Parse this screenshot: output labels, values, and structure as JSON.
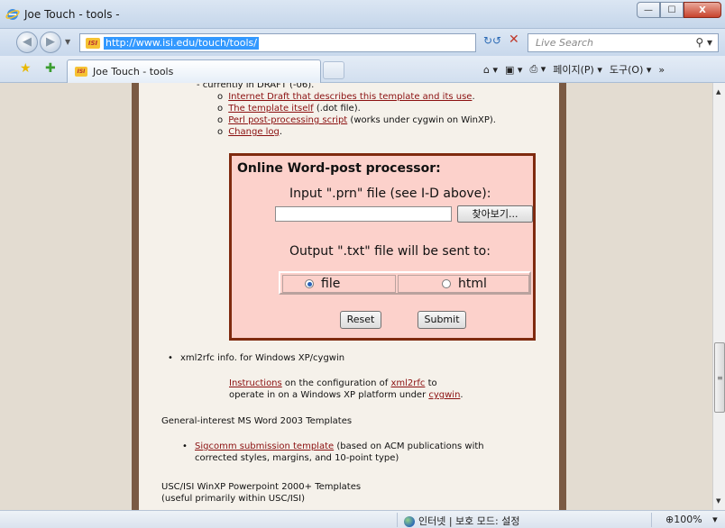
{
  "window": {
    "title": "Joe Touch - tools -",
    "minimize": "—",
    "maximize": "☐",
    "close": "X"
  },
  "nav": {
    "url": "http://www.isi.edu/touch/tools/",
    "search_placeholder": "Live Search",
    "back_glyph": "◀",
    "forward_glyph": "▶"
  },
  "tabs": [
    {
      "label": "Joe Touch - tools"
    }
  ],
  "command_bar": {
    "home": "⌂ ▾",
    "feeds": "▣ ▾",
    "print": "⎙ ▾",
    "page_menu": "페이지(P) ▾",
    "tools_menu": "도구(O) ▾",
    "more": "»"
  },
  "page": {
    "top_partial": "- currently in DRAFT (-06).",
    "links": [
      {
        "link": "Internet Draft that describes this template and its use",
        "suffix": "."
      },
      {
        "link": "The template itself",
        "suffix": " (.dot file)."
      },
      {
        "link": "Perl post-processing script",
        "suffix": " (works under cygwin on WinXP)."
      },
      {
        "link": "Change log",
        "suffix": "."
      }
    ],
    "word_post": {
      "title": "Online Word-post processor:",
      "input_label": "Input \".prn\" file (see I-D above):",
      "browse_button": "찾아보기...",
      "output_label": "Output \".txt\" file will be sent to:",
      "radio_file": "file",
      "radio_html": "html",
      "selected": "file",
      "reset_button": "Reset",
      "submit_button": "Submit"
    },
    "xml2rfc_heading": "xml2rfc info. for Windows XP/cygwin",
    "xml2rfc_text": {
      "link1": "Instructions",
      "mid1": " on the configuration of ",
      "link2": "xml2rfc",
      "mid2": " to",
      "line2_pre": "operate in on a Windows XP platform under ",
      "link3": "cygwin",
      "line2_post": "."
    },
    "word2003_heading": "General-interest MS Word 2003 Templates",
    "sigcomm": {
      "link": "Sigcomm submission template",
      "rest1": " (based on ACM publications with",
      "rest2": "corrected styles, margins, and 10-point type)"
    },
    "ppt_heading_1": "USC/ISI WinXP Powerpoint 2000+ Templates",
    "ppt_heading_2": "(useful primarily within USC/ISI)"
  },
  "status": {
    "zone": "인터넷 | 보호 모드: 설정",
    "zoom": "100%",
    "zoom_drop": "▾"
  },
  "colors": {
    "link": "#8b1010",
    "box_border": "#7f2a0f",
    "box_fill": "#fcd1cb",
    "side_dark": "#7a5a43"
  }
}
